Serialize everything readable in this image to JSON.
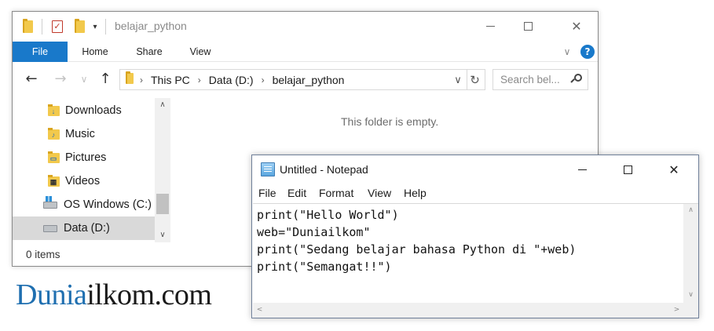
{
  "explorer": {
    "title": "belajar_python",
    "ribbon": {
      "file": "File",
      "home": "Home",
      "share": "Share",
      "view": "View"
    },
    "address": {
      "crumbs": [
        "This PC",
        "Data (D:)",
        "belajar_python"
      ]
    },
    "search": {
      "placeholder": "Search bel..."
    },
    "nav_items": [
      {
        "label": "Downloads",
        "icon": "downloads-folder-icon"
      },
      {
        "label": "Music",
        "icon": "music-folder-icon"
      },
      {
        "label": "Pictures",
        "icon": "pictures-folder-icon"
      },
      {
        "label": "Videos",
        "icon": "videos-folder-icon"
      },
      {
        "label": "OS Windows (C:)",
        "icon": "windows-drive-icon"
      },
      {
        "label": "Data (D:)",
        "icon": "drive-icon",
        "selected": true
      }
    ],
    "empty_message": "This folder is empty.",
    "status": "0 items"
  },
  "notepad": {
    "title": "Untitled - Notepad",
    "menu": [
      "File",
      "Edit",
      "Format",
      "View",
      "Help"
    ],
    "lines": [
      "print(\"Hello World\")",
      "web=\"Duniailkom\"",
      "print(\"Sedang belajar bahasa Python di \"+web)",
      "print(\"Semangat!!\")"
    ]
  },
  "logo": {
    "part1": "Dunia",
    "part2": "ilkom.com"
  },
  "colors": {
    "accent": "#1979ca",
    "selected": "#d9d9d9",
    "logo_blue": "#1f6fb0"
  }
}
